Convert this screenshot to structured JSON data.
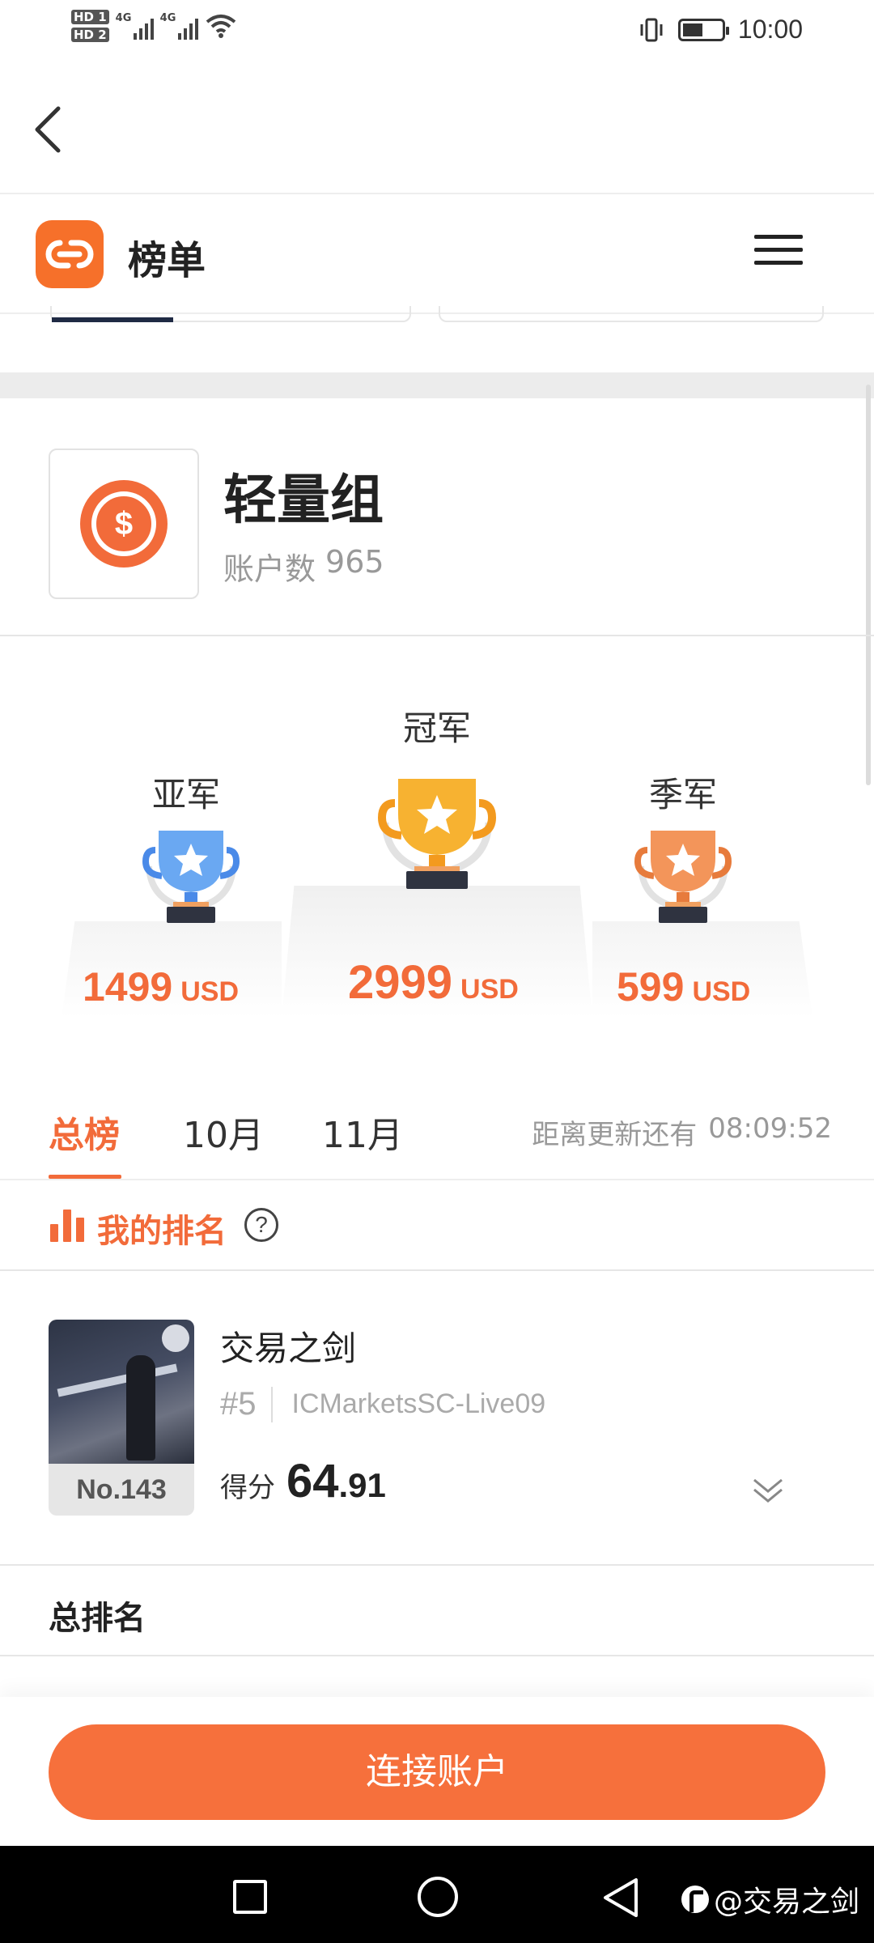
{
  "status_bar": {
    "hd1": "HD 1",
    "hd2": "HD 2",
    "net1": "4G",
    "net2": "4G",
    "time": "10:00",
    "icons": [
      "signal-icon",
      "wifi-icon",
      "vibrate-icon",
      "battery-icon"
    ]
  },
  "header": {
    "app_title": "榜单",
    "brand_color": "#f6702a"
  },
  "group": {
    "name": "轻量组",
    "count_label": "账户数",
    "count_value": "965"
  },
  "podium": {
    "second": {
      "title": "亚军",
      "amount": "1499",
      "unit": "USD",
      "color": "#5b9cf0"
    },
    "first": {
      "title": "冠军",
      "amount": "2999",
      "unit": "USD",
      "color": "#f5a623"
    },
    "third": {
      "title": "季军",
      "amount": "599",
      "unit": "USD",
      "color": "#f08a4b"
    }
  },
  "tabs": {
    "items": [
      {
        "label": "总榜",
        "active": true
      },
      {
        "label": "10月",
        "active": false
      },
      {
        "label": "11月",
        "active": false
      }
    ],
    "countdown_label": "距离更新还有",
    "countdown_value": "08:09:52"
  },
  "my_rank": {
    "title": "我的排名",
    "help": "?"
  },
  "entry": {
    "rank_no": "No.143",
    "name": "交易之剑",
    "sub_rank": "#5",
    "server": "ICMarketsSC-Live09",
    "score_label": "得分",
    "score_int": "64",
    "score_dec": ".91"
  },
  "total": {
    "title": "总排名"
  },
  "cta": {
    "label": "连接账户",
    "color": "#f6703c"
  },
  "watermark": {
    "text": "@交易之剑"
  }
}
